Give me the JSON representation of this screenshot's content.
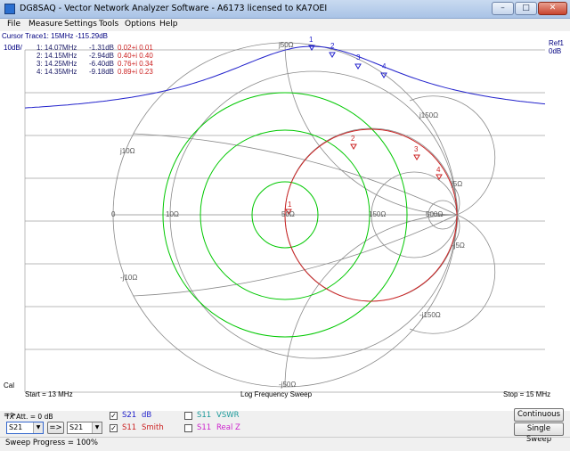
{
  "window": {
    "title": "DG8SAQ  -  Vector Network Analyzer Software  - A6173 licensed to KA7OEI",
    "min": "–",
    "max": "□",
    "close": "✕"
  },
  "menu": [
    "File",
    "Measure",
    "Settings",
    "Tools",
    "Options",
    "Help"
  ],
  "plot": {
    "cursor_header": "Cursor Trace1:  15MHz    -115.29dB",
    "left_scale": "10dB/",
    "right_ref": "Ref1",
    "right_unit": "0dB",
    "markers": [
      {
        "id": "1:",
        "freq": "14.07MHz",
        "db": "-1.31dB",
        "z": "0.02+i 0.01"
      },
      {
        "id": "2:",
        "freq": "14.15MHz",
        "db": "-2.94dB",
        "z": "0.40+i 0.40"
      },
      {
        "id": "3:",
        "freq": "14.25MHz",
        "db": "-6.40dB",
        "z": "0.76+i 0.34"
      },
      {
        "id": "4:",
        "freq": "14.35MHz",
        "db": "-9.18dB",
        "z": "0.89+i 0.23"
      }
    ],
    "marker_labels": [
      "1",
      "2",
      "3",
      "4"
    ],
    "smith_labels": {
      "j50": "j50Ω",
      "j150": "j150Ω",
      "j10": "j10Ω",
      "j5": "j5Ω",
      "mj5": "-j5Ω",
      "mj10": "-j10Ω",
      "mj150": "-j150Ω",
      "mj50": "-j50Ω",
      "r0": "0",
      "r10": "10Ω",
      "r50": "50Ω",
      "r150": "150Ω",
      "r500": "500Ω"
    },
    "cal": "Cal",
    "start": "Start = 13 MHz",
    "sweep_type": "Log Frequency Sweep",
    "stop": "Stop = 15 MHz"
  },
  "controls": {
    "arrow": "=>",
    "tx_att": "TX Att.  = 0 dB",
    "combo1": "S21",
    "swap": "=>",
    "combo2": "S21",
    "trace_rows": [
      {
        "checked": true,
        "param": "S21",
        "mode": "dB",
        "color": "#2222cc"
      },
      {
        "checked": true,
        "param": "S11",
        "mode": "Smith",
        "color": "#cc2222"
      }
    ],
    "extra_rows": [
      {
        "checked": false,
        "param": "S11",
        "mode": "VSWR",
        "color": "#1a9a9a"
      },
      {
        "checked": false,
        "param": "S11",
        "mode": "Real Z",
        "color": "#cc22cc"
      }
    ],
    "continuous": "Continuous",
    "single_sweep": "Single Sweep",
    "sweep_progress": "Sweep Progress = 100%"
  },
  "chart_data": {
    "type": "line",
    "x": [
      "13 MHz",
      "15 MHz"
    ],
    "series": [
      {
        "name": "S21",
        "values_db": [
          -1.31,
          -2.94,
          -6.4,
          -9.18
        ]
      },
      {
        "name": "S11",
        "values_z": [
          "0.02+i 0.01",
          "0.40+i 0.40",
          "0.76+i 0.34",
          "0.89+i 0.23"
        ]
      }
    ],
    "colors": {
      "s21": "#2222cc",
      "s11": "#cc2222",
      "smith_grid": "#8a8a8a",
      "green": "#00c800",
      "hgrid": "#a0a0a0"
    }
  }
}
